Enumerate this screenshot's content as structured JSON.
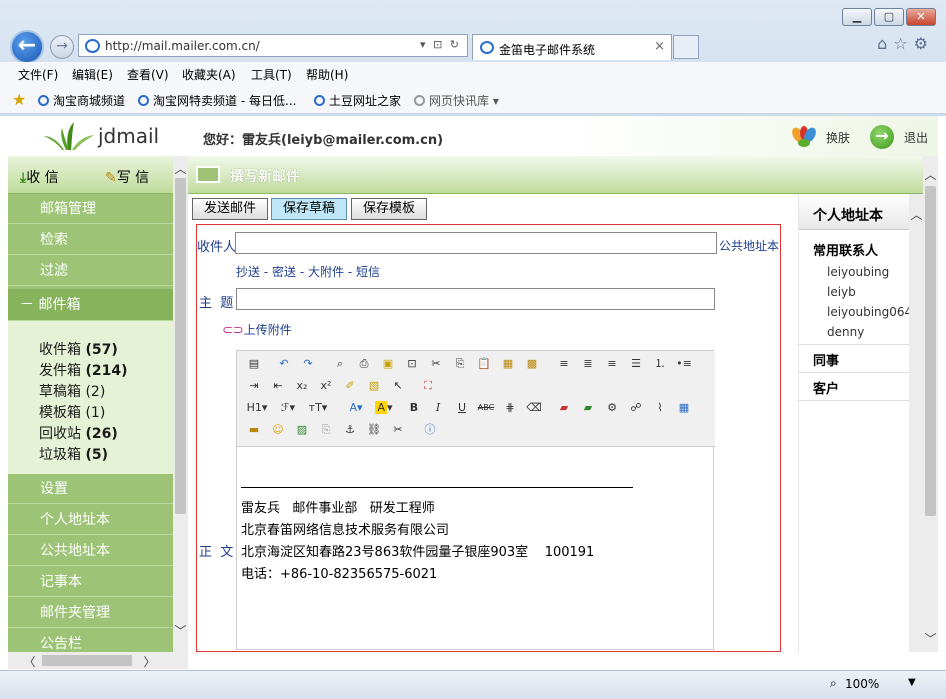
{
  "browser": {
    "url": "http://mail.mailer.com.cn/",
    "tab_title": "金笛电子邮件系统",
    "tab_close": "×",
    "menus": [
      "文件(F)",
      "编辑(E)",
      "查看(V)",
      "收藏夹(A)",
      "工具(T)",
      "帮助(H)"
    ],
    "favorites": [
      "淘宝商城频道",
      "淘宝网特卖频道 - 每日低...",
      "土豆网址之家",
      "网页快讯库 ▾"
    ],
    "zoom": "100%"
  },
  "header": {
    "logo": "jdmail",
    "greeting": "您好：雷友兵(leiyb@mailer.com.cn)",
    "skin": "换肤",
    "logout": "退出"
  },
  "nav": {
    "receive": "收 信",
    "compose": "写 信",
    "items_top": [
      "邮箱管理",
      "检索",
      "过滤"
    ],
    "mailbox": "－  邮件箱",
    "folders": [
      {
        "name": "收件箱",
        "count": "(57)"
      },
      {
        "name": "发件箱",
        "count": "(214)"
      },
      {
        "name": "草稿箱",
        "count": "(2)"
      },
      {
        "name": "模板箱",
        "count": "(1)"
      },
      {
        "name": "回收站",
        "count": "(26)"
      },
      {
        "name": "垃圾箱",
        "count": "(5)"
      }
    ],
    "items_bottom": [
      "设置",
      "个人地址本",
      "公共地址本",
      "记事本",
      "邮件夹管理",
      "公告栏"
    ]
  },
  "compose": {
    "title": "撰写新邮件",
    "send": "发送邮件",
    "save_draft": "保存草稿",
    "save_template": "保存模板",
    "to_label": "收件人",
    "public_addr": "公共地址本",
    "cc": "抄送",
    "bcc": "密送",
    "big_attach": "大附件",
    "sms": "短信",
    "sep": "-",
    "subject_label": "主  题",
    "upload": "上传附件",
    "body_label": "正  文",
    "signature": [
      "雷友兵   邮件事业部   研发工程师",
      "北京春笛网络信息技术服务有限公司",
      "北京海淀区知春路23号863软件园量子银座903室    100191",
      "电话：+86-10-82356575-6021"
    ]
  },
  "addressbook": {
    "title": "个人地址本",
    "frequent": "常用联系人",
    "contacts": [
      "leiyoubing",
      "leiyb",
      "leiyoubing064",
      "denny"
    ],
    "colleagues": "同事",
    "clients": "客户"
  },
  "colors": {
    "nav_green": "#9dc476",
    "accent_red": "#dd3333",
    "link_blue": "#1f3f8f"
  }
}
